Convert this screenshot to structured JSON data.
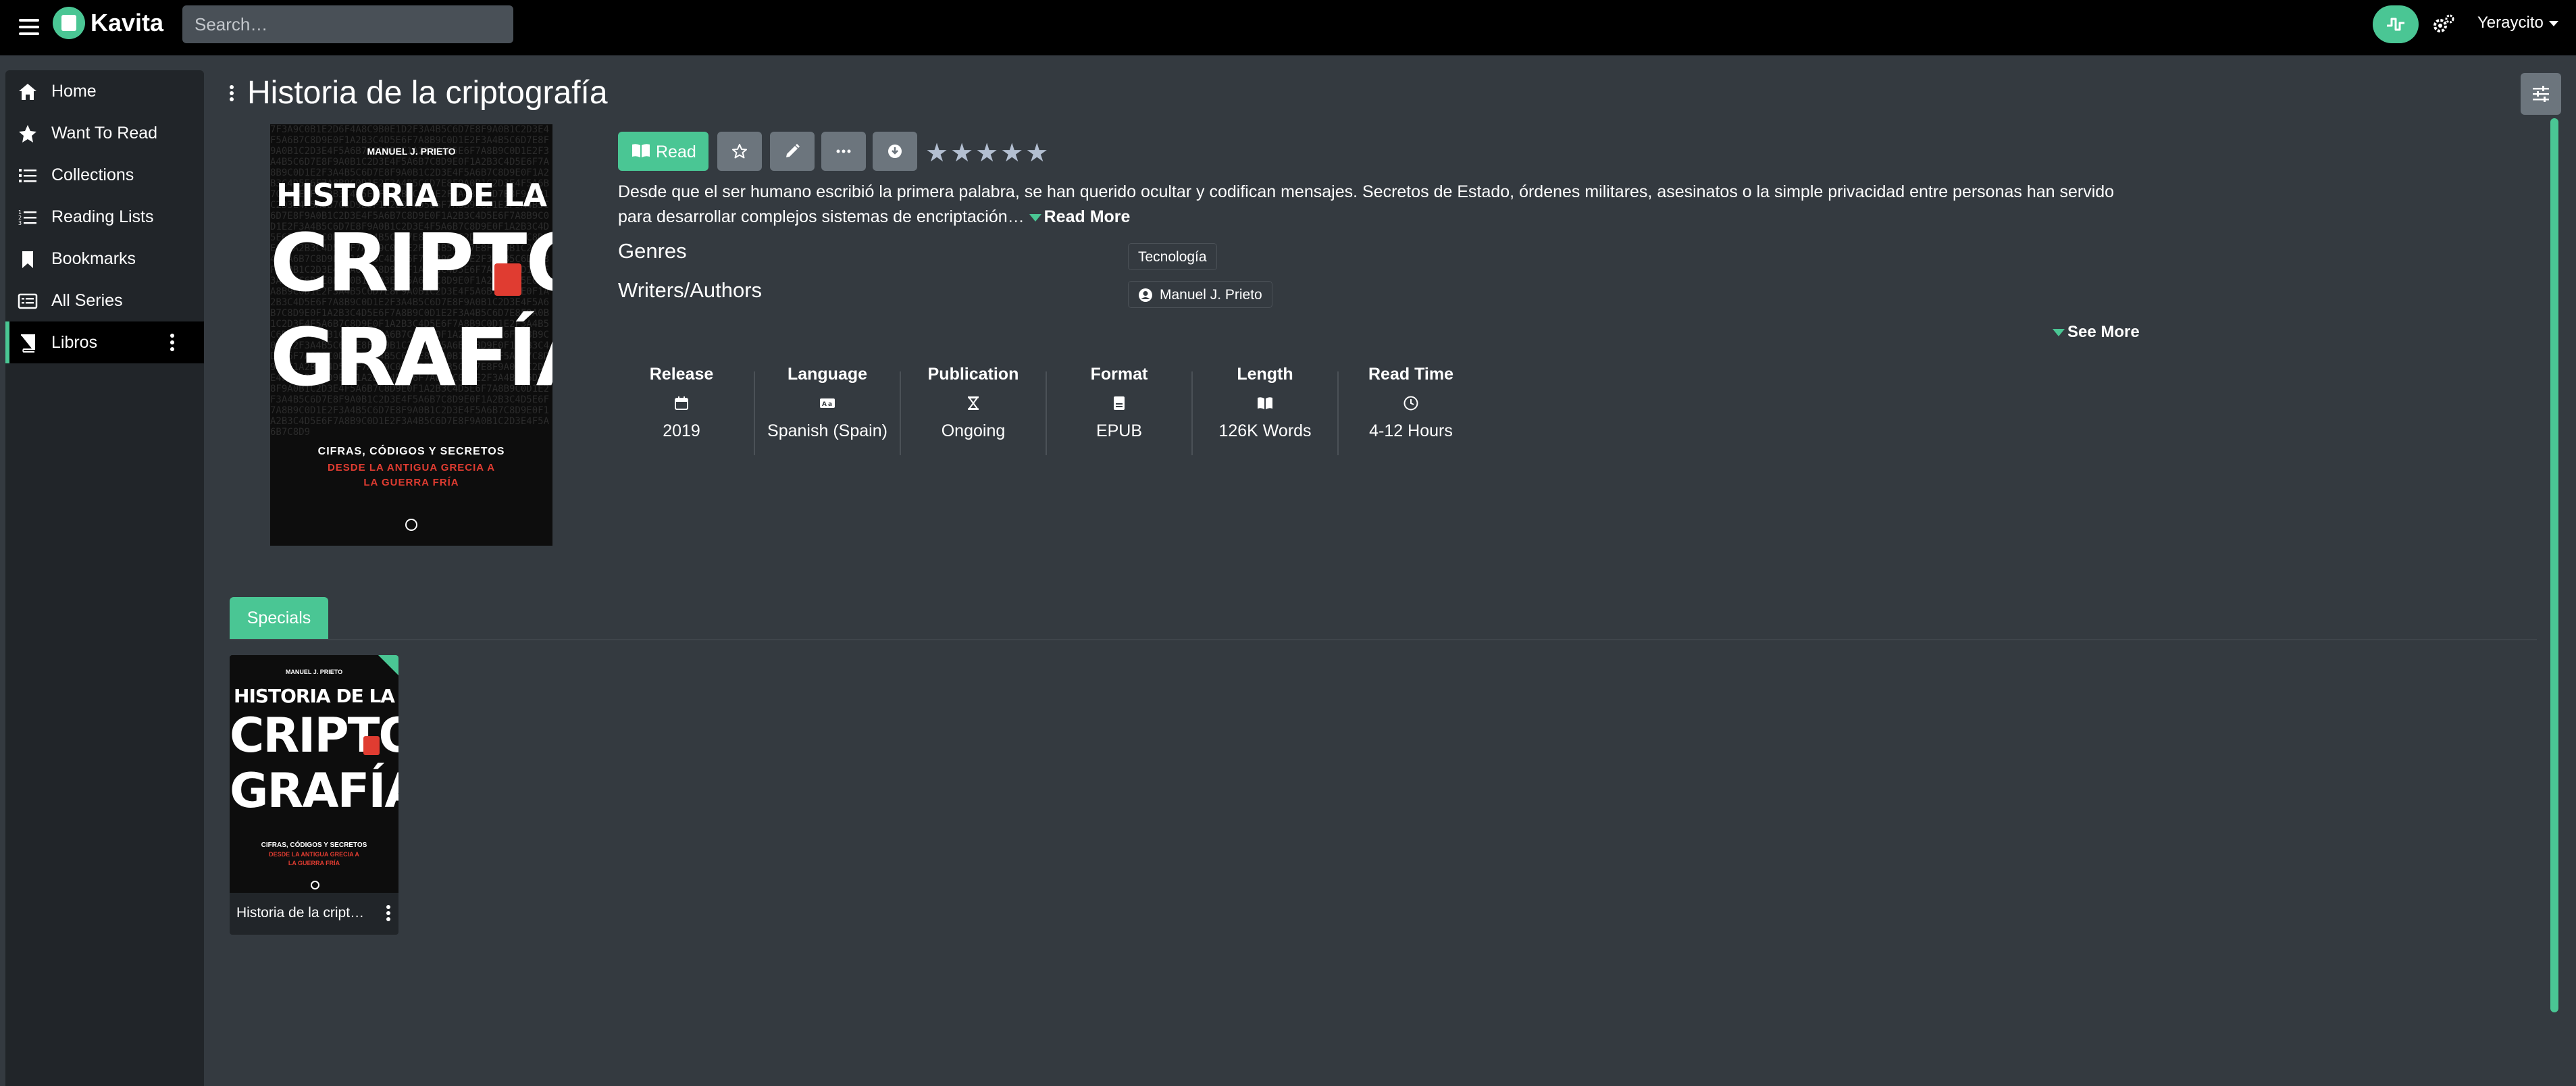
{
  "app": {
    "name": "Kavita",
    "user": "Yeraycito"
  },
  "search": {
    "placeholder": "Search…"
  },
  "sidebar": {
    "items": [
      {
        "label": "Home",
        "icon": "home-icon"
      },
      {
        "label": "Want To Read",
        "icon": "star-icon"
      },
      {
        "label": "Collections",
        "icon": "list-icon"
      },
      {
        "label": "Reading Lists",
        "icon": "ordered-list-icon"
      },
      {
        "label": "Bookmarks",
        "icon": "bookmark-icon"
      },
      {
        "label": "All Series",
        "icon": "all-series-icon"
      },
      {
        "label": "Libros",
        "icon": "book-icon",
        "active": true
      }
    ]
  },
  "series": {
    "title": "Historia de la criptografía",
    "read_label": "Read",
    "rating_stars": "★★★★★",
    "rating": 0,
    "summary": "Desde que el ser humano escribió la primera palabra, se han querido ocultar y codifican mensajes. Secretos de Estado, órdenes militares, asesinatos o la simple privacidad entre personas han servido para desarrollar complejos sistemas de encriptación…",
    "read_more": "Read More",
    "genres_label": "Genres",
    "genres": [
      "Tecnología"
    ],
    "writers_label": "Writers/Authors",
    "writers": [
      "Manuel J. Prieto"
    ],
    "see_more": "See More",
    "cover": {
      "author": "MANUEL J. PRIETO",
      "title_line1": "HISTORIA DE LA",
      "title_line2": "CRIPTO",
      "title_line3": "GRAFÍA",
      "subtitle": "CIFRAS, CÓDIGOS Y SECRETOS",
      "subtitle_red1": "DESDE LA ANTIGUA GRECIA A",
      "subtitle_red2": "LA GUERRA FRÍA"
    },
    "stats": [
      {
        "heading": "Release",
        "value": "2019",
        "icon": "calendar-icon"
      },
      {
        "heading": "Language",
        "value": "Spanish (Spain)",
        "icon": "language-icon"
      },
      {
        "heading": "Publication",
        "value": "Ongoing",
        "icon": "hourglass-icon"
      },
      {
        "heading": "Format",
        "value": "EPUB",
        "icon": "file-icon"
      },
      {
        "heading": "Length",
        "value": "126K Words",
        "icon": "open-book-icon"
      },
      {
        "heading": "Read Time",
        "value": "4-12 Hours",
        "icon": "clock-icon"
      }
    ]
  },
  "tabs": [
    {
      "label": "Specials",
      "active": true
    }
  ],
  "specials": [
    {
      "title": "Historia de la criptografía"
    }
  ],
  "colors": {
    "accent": "#4ac694",
    "background": "#343a40",
    "sidebar": "#212529",
    "topbar": "#000000",
    "button": "#6c757d"
  }
}
